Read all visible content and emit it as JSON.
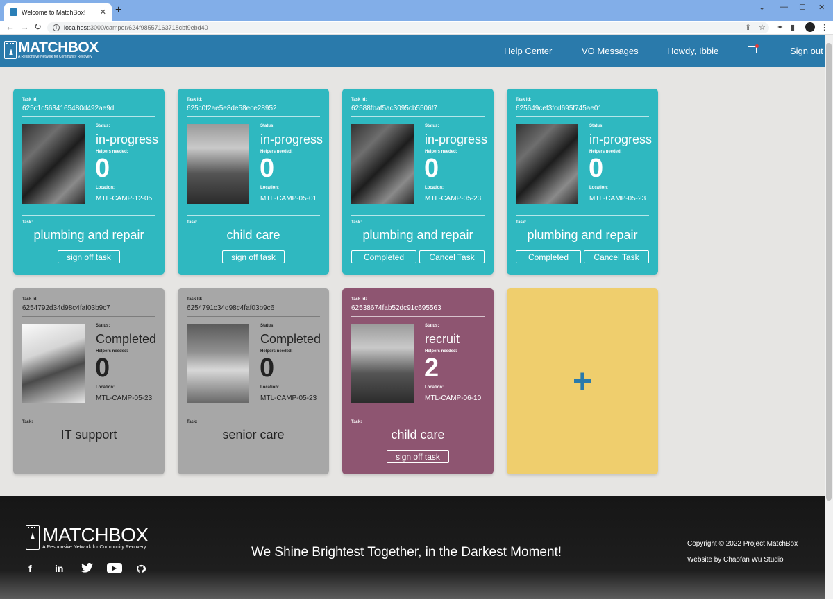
{
  "browser": {
    "tab_title": "Welcome to MatchBox!",
    "url_host": "localhost",
    "url_path": ":3000/camper/624f98557163718cbf9ebd40"
  },
  "header": {
    "brand": "MATCHBOX",
    "tagline": "A Responsive Network for Community Recovery",
    "nav": {
      "help": "Help Center",
      "messages": "VO Messages",
      "greeting": "Howdy, Ibbie",
      "signout": "Sign out"
    }
  },
  "labels": {
    "task_id": "Task Id:",
    "status": "Status:",
    "helpers": "Helpers needed:",
    "location": "Location:",
    "task": "Task:"
  },
  "cards": [
    {
      "id": "625c1c5634165480d492ae9d",
      "status": "in-progress",
      "helpers": "0",
      "location": "MTL-CAMP-12-05",
      "task": "plumbing and repair",
      "buttons": [
        "sign off task"
      ]
    },
    {
      "id": "625c0f2ae5e8de58ece28952",
      "status": "in-progress",
      "helpers": "0",
      "location": "MTL-CAMP-05-01",
      "task": "child care",
      "buttons": [
        "sign off task"
      ]
    },
    {
      "id": "62588fbaf5ac3095cb5506f7",
      "status": "in-progress",
      "helpers": "0",
      "location": "MTL-CAMP-05-23",
      "task": "plumbing and repair",
      "buttons": [
        "Completed",
        "Cancel Task"
      ]
    },
    {
      "id": "625649cef3fcd695f745ae01",
      "status": "in-progress",
      "helpers": "0",
      "location": "MTL-CAMP-05-23",
      "task": "plumbing and repair",
      "buttons": [
        "Completed",
        "Cancel Task"
      ]
    },
    {
      "id": "6254792d34d98c4faf03b9c7",
      "status": "Completed",
      "helpers": "0",
      "location": "MTL-CAMP-05-23",
      "task": "IT support",
      "buttons": []
    },
    {
      "id": "6254791c34d98c4faf03b9c6",
      "status": "Completed",
      "helpers": "0",
      "location": "MTL-CAMP-05-23",
      "task": "senior care",
      "buttons": []
    },
    {
      "id": "62538674fab52dc91c695563",
      "status": "recruit",
      "helpers": "2",
      "location": "MTL-CAMP-06-10",
      "task": "child care",
      "buttons": [
        "sign off task"
      ]
    }
  ],
  "add_card": {
    "symbol": "+"
  },
  "footer": {
    "brand": "MATCHBOX",
    "tagline": "A Responsive Network for Community Recovery",
    "slogan": "We Shine Brightest Together, in the Darkest Moment!",
    "copyright": "Copyright © 2022 Project MatchBox",
    "credit": "Website by Chaofan Wu Studio",
    "social": {
      "facebook": "f",
      "linkedin": "in",
      "youtube": "▶"
    }
  },
  "colors": {
    "header": "#2a7aab",
    "teal_card": "#2fb8c0",
    "grey_card": "#a7a7a7",
    "purple_card": "#8e5571",
    "add_card": "#efce6d"
  }
}
